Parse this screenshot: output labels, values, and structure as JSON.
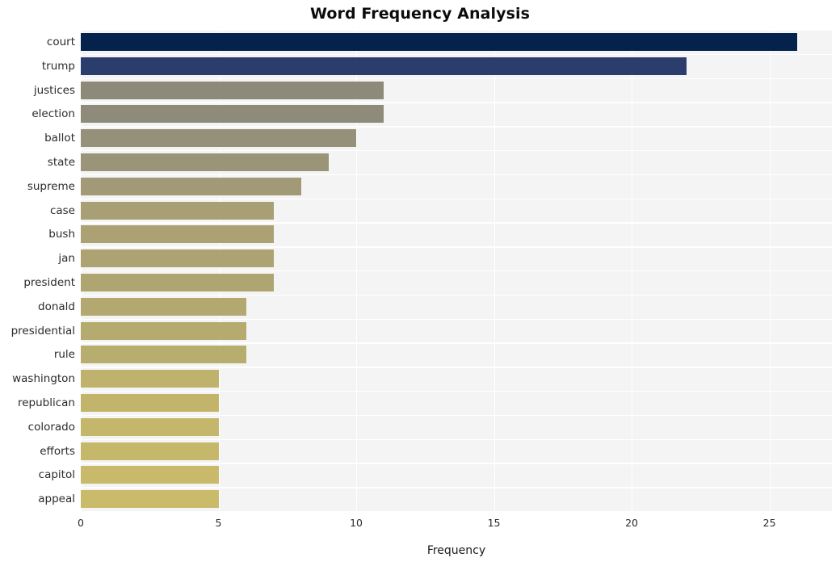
{
  "chart_data": {
    "type": "bar",
    "orientation": "horizontal",
    "title": "Word Frequency Analysis",
    "xlabel": "Frequency",
    "ylabel": "",
    "categories": [
      "court",
      "trump",
      "justices",
      "election",
      "ballot",
      "state",
      "supreme",
      "case",
      "bush",
      "jan",
      "president",
      "donald",
      "presidential",
      "rule",
      "washington",
      "republican",
      "colorado",
      "efforts",
      "capitol",
      "appeal"
    ],
    "values": [
      26,
      22,
      11,
      11,
      10,
      9,
      8,
      7,
      7,
      7,
      7,
      6,
      6,
      6,
      5,
      5,
      5,
      5,
      5,
      5
    ],
    "bar_colors": [
      "#04224c",
      "#2a3d6d",
      "#8d8a79",
      "#8e8b7a",
      "#95907a",
      "#9a9478",
      "#a29a76",
      "#a89f74",
      "#aba172",
      "#ada372",
      "#afa571",
      "#b3a970",
      "#b5ab6f",
      "#b7ad6f",
      "#bfb26c",
      "#c2b56b",
      "#c4b76b",
      "#c6b86a",
      "#c8ba6a",
      "#c9bb6a"
    ],
    "xlim": [
      0,
      27.27
    ],
    "xticks": [
      0,
      5,
      10,
      15,
      20,
      25
    ],
    "xtick_labels": [
      "0",
      "5",
      "10",
      "15",
      "20",
      "25"
    ],
    "grid": true,
    "grid_color": "#ffffff",
    "plot_background": "#f4f4f5",
    "figure_background": "#ffffff",
    "legend": null
  }
}
